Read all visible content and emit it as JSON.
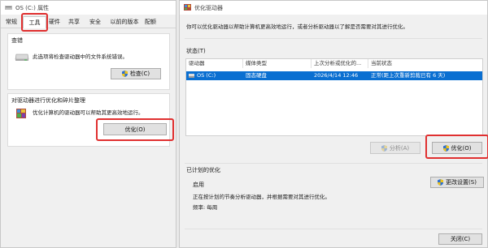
{
  "left": {
    "title": "OS (C:) 属性",
    "tabs": [
      "常规",
      "工具",
      "硬件",
      "共享",
      "安全",
      "以前的版本",
      "配额"
    ],
    "check": {
      "heading": "查错",
      "desc": "此选项将检查驱动器中的文件系统错误。",
      "button": "检查(C)"
    },
    "optimize": {
      "heading": "对驱动器进行优化和碎片整理",
      "desc": "优化计算机的驱动器可以帮助其更高效地运行。",
      "button": "优化(O)"
    }
  },
  "right": {
    "title": "优化驱动器",
    "intro": "你可以优化驱动器以帮助计算机更高效地运行，或者分析驱动器以了解是否需要对其进行优化。",
    "status_label": "状态(T)",
    "columns": [
      "驱动器",
      "媒体类型",
      "上次分析或优化的...",
      "当前状态"
    ],
    "rows": [
      {
        "drive": "OS (C:)",
        "media": "固态硬盘",
        "last": "2026/4/14 12:46",
        "status": "正常(距上次重新剪裁已有 6 天)"
      }
    ],
    "analyze_button": "分析(A)",
    "optimize_button": "优化(O)",
    "scheduled": {
      "heading": "已计划的优化",
      "state": "启用",
      "desc": "正在按计划的节奏分析驱动器，并根据需要对其进行优化。",
      "frequency": "频率: 每周",
      "change_button": "更改设置(S)"
    },
    "close_button": "关闭(C)"
  },
  "colors": {
    "highlight": "#e03030",
    "selection": "#0a6fd1"
  },
  "icons": [
    "drive-icon",
    "defrag-icon",
    "shield-icon",
    "app-icon"
  ]
}
